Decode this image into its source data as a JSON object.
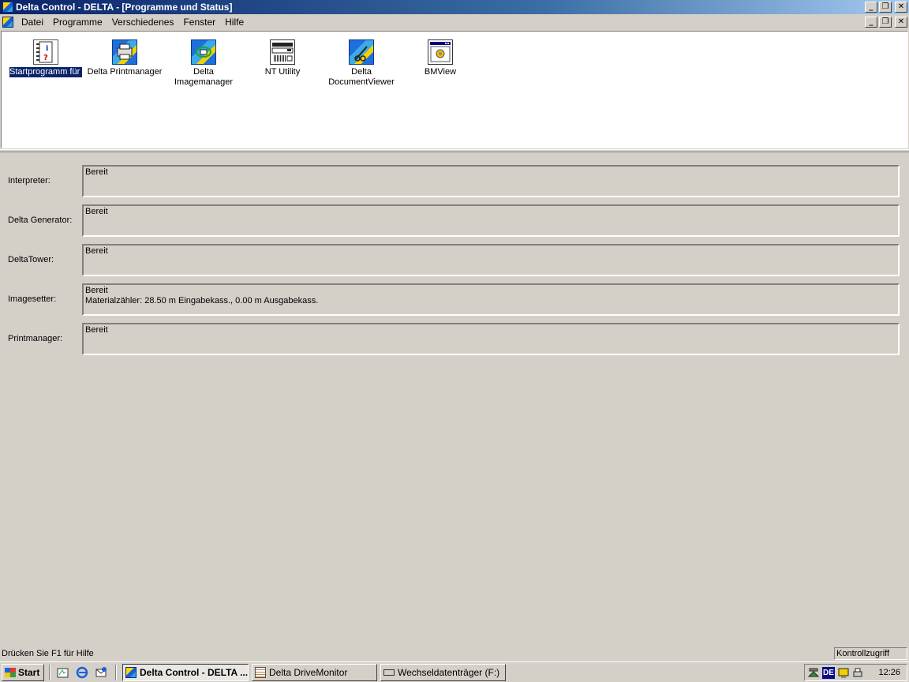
{
  "window": {
    "title": "Delta Control - DELTA - [Programme und Status]"
  },
  "menu": [
    "Datei",
    "Programme",
    "Verschiedenes",
    "Fenster",
    "Hilfe"
  ],
  "programs": [
    {
      "label": "Startprogramm für Ereignisanzeige-Snap",
      "icon": "info-book-icon",
      "selected": true
    },
    {
      "label": "Delta Printmanager",
      "icon": "printmanager-icon"
    },
    {
      "label": "Delta Imagemanager",
      "icon": "imagemanager-icon"
    },
    {
      "label": "NT Utility",
      "icon": "nt-utility-icon"
    },
    {
      "label": "Delta DocumentViewer",
      "icon": "documentviewer-icon"
    },
    {
      "label": "BMView",
      "icon": "bmview-icon"
    }
  ],
  "status": [
    {
      "label": "Interpreter:",
      "value": "Bereit"
    },
    {
      "label": "Delta Generator:",
      "value": "Bereit"
    },
    {
      "label": "DeltaTower:",
      "value": "Bereit"
    },
    {
      "label": "Imagesetter:",
      "value": "Bereit",
      "value2": "Materialzähler: 28.50 m Eingabekass., 0.00 m Ausgabekass."
    },
    {
      "label": "Printmanager:",
      "value": "Bereit"
    }
  ],
  "statusbar": {
    "help": "Drücken Sie F1 für Hilfe",
    "pane": "Kontrollzugriff"
  },
  "taskbar": {
    "start": "Start",
    "tasks": [
      "Delta Control - DELTA ...",
      "Delta DriveMonitor",
      "Wechseldatenträger (F:)"
    ],
    "lang": "DE",
    "clock": "12:26"
  }
}
